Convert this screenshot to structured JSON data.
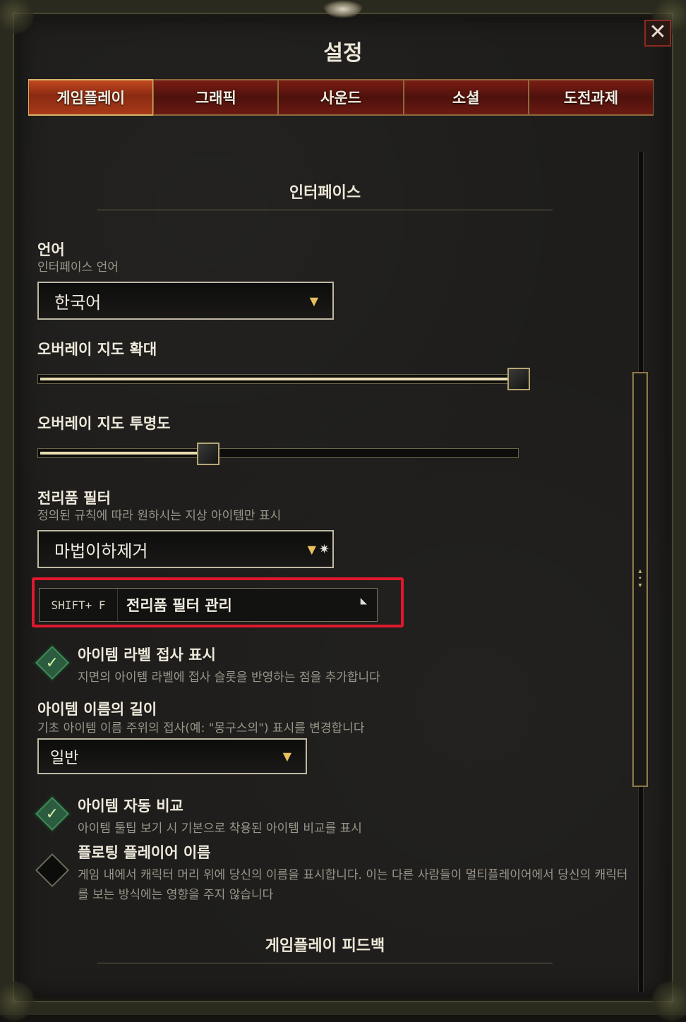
{
  "window": {
    "title": "설정",
    "close_label": "✕"
  },
  "tabs": [
    {
      "label": "게임플레이",
      "active": true
    },
    {
      "label": "그래픽"
    },
    {
      "label": "사운드"
    },
    {
      "label": "소셜"
    },
    {
      "label": "도전과제"
    }
  ],
  "sections": {
    "interface": "인터페이스",
    "gameplay_feedback": "게임플레이 피드백"
  },
  "language": {
    "label": "언어",
    "desc": "인터페이스 언어",
    "value": "한국어"
  },
  "overlay_zoom": {
    "label": "오버레이 지도 확대",
    "value": 1.0
  },
  "overlay_opacity": {
    "label": "오버레이 지도 투명도",
    "value": 0.34
  },
  "loot_filter": {
    "label": "전리품 필터",
    "desc": "정의된 규칙에 따라 원하시는 지상 아이템만 표시",
    "value": "마법이하제거",
    "hotkey": "SHIFT+ F",
    "manage_label": "전리품 필터 관리"
  },
  "item_affix": {
    "label": "아이템 라벨 접사 표시",
    "desc": "지면의 아이템 라벨에 접사 슬롯을 반영하는 점을 추가합니다",
    "checked": true
  },
  "item_name_length": {
    "label": "아이템 이름의 길이",
    "desc": "기초 아이템 이름 주위의 접사(예: \"몽구스의\") 표시를 변경합니다",
    "value": "일반"
  },
  "auto_compare": {
    "label": "아이템 자동 비교",
    "desc": "아이템 툴팁 보기 시 기본으로 착용된 아이템 비교를 표시",
    "checked": true
  },
  "floating_name": {
    "label": "플로팅 플레이어 이름",
    "desc": "게임 내에서 캐릭터 머리 위에 당신의 이름을 표시합니다. 이는 다른 사람들이 멀티플레이어에서 당신의 캐릭터를 보는 방식에는 영향을 주지 않습니다",
    "checked": false
  },
  "icons": {
    "dropdown": "▼",
    "check": "✓",
    "settings_gear": "✷"
  }
}
